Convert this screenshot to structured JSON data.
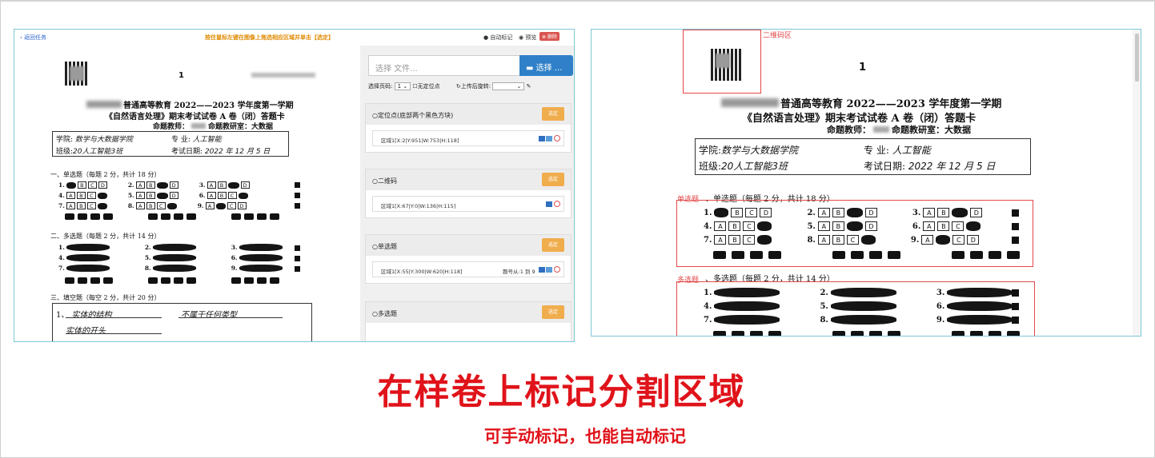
{
  "left": {
    "back": "返回任务",
    "hint": "按住鼠标左键在图像上拖选相应区域并单击【选定】",
    "auto_mark": "自动标记",
    "preview": "预览",
    "delete": "删除",
    "file_placeholder": "选择 文件...",
    "choose_button": "选择 ...",
    "page_label": "选择页码:",
    "page_value": "1",
    "no_anchor": "无定位点",
    "rotate_label": "上传后旋转:",
    "cards": [
      {
        "title": "定位点(底部两个黑色方块)",
        "pick": "选定",
        "region": "区域1[X:2|Y:951|W:753|H:118]",
        "extra": ""
      },
      {
        "title": "二维码",
        "pick": "选定",
        "region": "区域1[X:67|Y:0|W:136|H:115]",
        "extra": ""
      },
      {
        "title": "单选题",
        "pick": "选定",
        "region": "区域1[X:55|Y:300|W:620|H:118]",
        "extra": "题号从:1 到 9"
      },
      {
        "title": "多选题",
        "pick": "选定",
        "region": "",
        "extra": ""
      }
    ]
  },
  "sheet": {
    "page_num": "1",
    "title1": "普通高等教育 2022——2023 学年度第一学期",
    "title2": "《自然语言处理》期末考试试卷 A 卷（闭）答题卡",
    "title3": "命题教师：",
    "title3b": "命题教研室：大数据",
    "college_label": "学院:",
    "college_value": "数学与大数据学院",
    "major_label": "专    业:",
    "major_value": "人工智能",
    "class_label": "班级:",
    "class_value": "20人工智能3班",
    "date_label": "考试日期:",
    "date_value": "2022 年 12 月 5 日",
    "single_title": "一、单选题（每题 2 分，共计 18 分）",
    "multi_title": "二、多选题（每题 2 分，共计 14 分）",
    "fill_title": "三、填空题（每空 2 分，共计 20 分）",
    "fill_1a": "实体的结构",
    "fill_1b": "不属于任何类型",
    "fill_1c": "实体的开头",
    "single_rows": [
      [
        "1.",
        "2.",
        "3."
      ],
      [
        "4.",
        "5.",
        "6."
      ],
      [
        "7.",
        "8.",
        "9."
      ]
    ],
    "options": [
      "A",
      "B",
      "C",
      "D"
    ]
  },
  "right": {
    "qr_label": "二维码区",
    "single_label": "单选题",
    "single_title": "、单选题（每题 2 分，共计 18 分）",
    "multi_label": "多选题",
    "multi_title": "、多选题（每题 2 分，共计 14 分）"
  },
  "caption": {
    "main": "在样卷上标记分割区域",
    "sub": "可手动标记，也能自动标记"
  },
  "colors": {
    "accent_red": "#e0131a",
    "button_blue": "#2f80c8",
    "button_orange": "#f0ad4e",
    "frame_red": "#e34848"
  }
}
